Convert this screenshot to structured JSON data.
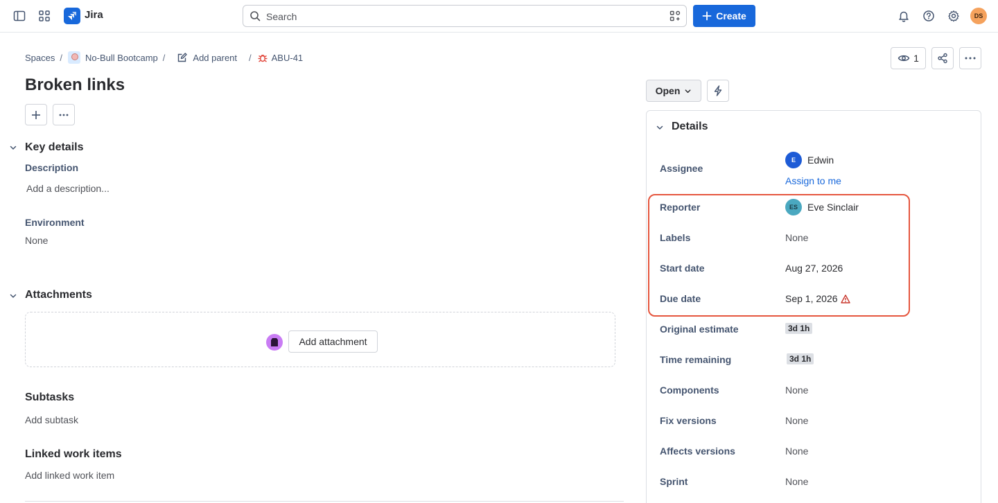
{
  "topbar": {
    "app_name": "Jira",
    "search_placeholder": "Search",
    "create_label": "Create",
    "user_initials": "DS"
  },
  "breadcrumb": {
    "spaces": "Spaces",
    "project": "No-Bull Bootcamp",
    "add_parent": "Add parent",
    "issue_key": "ABU-41"
  },
  "header_actions": {
    "watchers_count": "1"
  },
  "issue": {
    "title": "Broken links",
    "key_details_heading": "Key details",
    "description_label": "Description",
    "description_placeholder": "Add a description...",
    "environment_label": "Environment",
    "environment_value": "None",
    "attachments_heading": "Attachments",
    "add_attachment_label": "Add attachment",
    "subtasks_heading": "Subtasks",
    "add_subtask_label": "Add subtask",
    "linked_heading": "Linked work items",
    "add_linked_label": "Add linked work item"
  },
  "status": {
    "label": "Open"
  },
  "details": {
    "heading": "Details",
    "assignee_label": "Assignee",
    "assignee_name": "Edwin",
    "assignee_initial": "E",
    "assign_to_me": "Assign to me",
    "reporter_label": "Reporter",
    "reporter_name": "Eve Sinclair",
    "reporter_initials": "ES",
    "labels_label": "Labels",
    "labels_value": "None",
    "start_date_label": "Start date",
    "start_date_value": "Aug 27, 2026",
    "due_date_label": "Due date",
    "due_date_value": "Sep 1, 2026",
    "original_estimate_label": "Original estimate",
    "original_estimate_value": "3d 1h",
    "time_remaining_label": "Time remaining",
    "time_remaining_value": "3d 1h",
    "components_label": "Components",
    "components_value": "None",
    "fix_versions_label": "Fix versions",
    "fix_versions_value": "None",
    "affects_versions_label": "Affects versions",
    "affects_versions_value": "None",
    "sprint_label": "Sprint",
    "sprint_value": "None"
  },
  "colors": {
    "brand": "#1868db",
    "highlight_border": "#e5553d",
    "warning": "#c9372c"
  }
}
